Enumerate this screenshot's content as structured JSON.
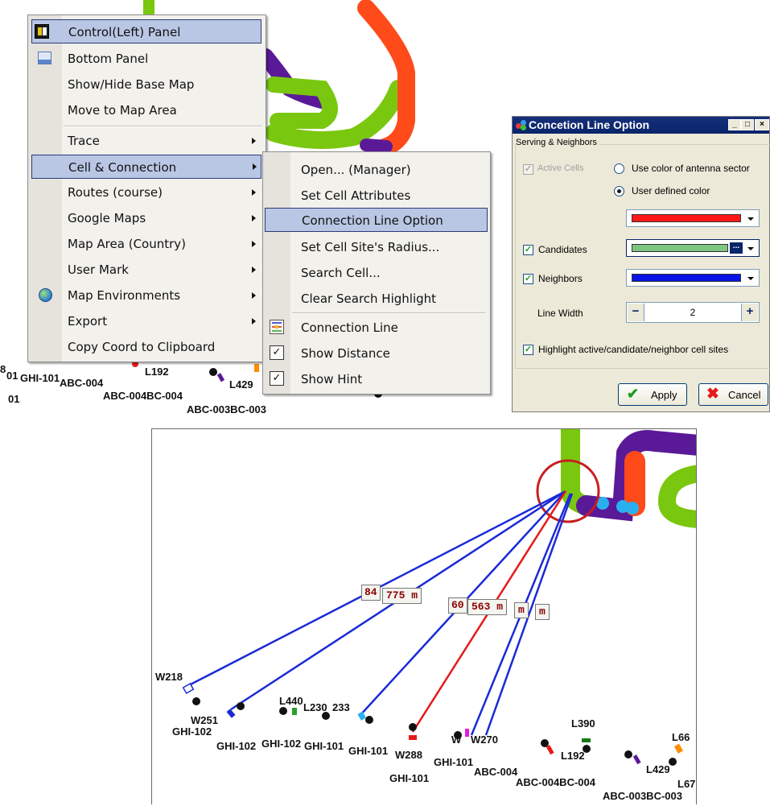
{
  "top_map": {
    "labels": [
      "GHI-101",
      "ABC-004",
      "L192",
      "L429",
      "ABC-004BC-004",
      "ABC-003BC-003",
      "L67",
      "01",
      "8",
      "ABC-004"
    ]
  },
  "context_menu": {
    "items": [
      {
        "label": "Control(Left) Panel",
        "icon": "panel-icon"
      },
      {
        "label": "Bottom Panel",
        "icon": "bottom-panel-icon"
      },
      {
        "label": "Show/Hide Base Map"
      },
      {
        "label": "Move to Map Area"
      },
      {
        "label": "Trace",
        "submenu": true
      },
      {
        "label": "Cell & Connection",
        "submenu": true
      },
      {
        "label": "Routes (course)",
        "submenu": true
      },
      {
        "label": "Google Maps",
        "submenu": true
      },
      {
        "label": "Map Area (Country)",
        "submenu": true
      },
      {
        "label": "User Mark",
        "submenu": true
      },
      {
        "label": "Map Environments",
        "submenu": true,
        "icon": "globe-icon"
      },
      {
        "label": "Export",
        "submenu": true
      },
      {
        "label": "Copy Coord to Clipboard"
      }
    ]
  },
  "submenu": {
    "items": [
      {
        "label": "Open... (Manager)"
      },
      {
        "label": "Set Cell Attributes"
      },
      {
        "label": "Connection Line Option"
      },
      {
        "label": "Set Cell Site's Radius..."
      },
      {
        "label": "Search Cell..."
      },
      {
        "label": "Clear Search Highlight"
      },
      {
        "label": "Connection Line",
        "icon": "connection-line-icon"
      },
      {
        "label": "Show Distance",
        "checked": true
      },
      {
        "label": "Show Hint",
        "checked": true
      }
    ]
  },
  "dialog": {
    "title": "Concetion Line Option",
    "group_label": "Serving & Neighbors",
    "active_cells_label": "Active Cells",
    "radio_antenna": "Use color of antenna sector",
    "radio_user": "User defined color",
    "active_color": "#ff1a1a",
    "candidates_label": "Candidates",
    "candidates_color": "#7fc47f",
    "candidates_ellipsis": "...",
    "neighbors_label": "Neighbors",
    "neighbors_color": "#0a14e6",
    "line_width_label": "Line Width",
    "line_width_value": "2",
    "minus": "−",
    "plus": "+",
    "highlight_label": "Highlight active/candidate/neighbor cell sites",
    "apply_label": "Apply",
    "cancel_label": "Cancel",
    "minimize": "_",
    "maximize": "□",
    "close": "×"
  },
  "map": {
    "distance_labels": [
      "84",
      "775 m",
      "60",
      "563 m",
      "m",
      "m"
    ],
    "site_labels": [
      "W218",
      "W251",
      "GHI-102",
      "GHI-102",
      "GHI-102",
      "L440",
      "L230",
      "233",
      "GHI-101",
      "GHI-101",
      "W288",
      "GHI-101",
      "W",
      "W270",
      "GHI-101",
      "ABC-004",
      "L192",
      "L390",
      "ABC-004BC-004",
      "L429",
      "L66",
      "ABC-003BC-003",
      "L67"
    ]
  },
  "colors": {
    "highlight": "#b9c7e4",
    "route_green": "#7ac70f",
    "route_purple": "#5a1a98",
    "route_red": "#ff4a1a",
    "line_blue": "#1a2ad8",
    "line_red": "#e61a1a"
  }
}
